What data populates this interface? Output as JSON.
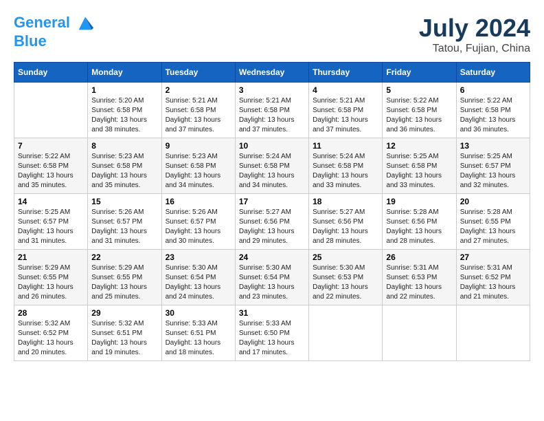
{
  "header": {
    "logo_line1": "General",
    "logo_line2": "Blue",
    "month_year": "July 2024",
    "location": "Tatou, Fujian, China"
  },
  "columns": [
    "Sunday",
    "Monday",
    "Tuesday",
    "Wednesday",
    "Thursday",
    "Friday",
    "Saturday"
  ],
  "weeks": [
    [
      {
        "day": "",
        "sunrise": "",
        "sunset": "",
        "daylight": ""
      },
      {
        "day": "1",
        "sunrise": "5:20 AM",
        "sunset": "6:58 PM",
        "daylight": "13 hours and 38 minutes."
      },
      {
        "day": "2",
        "sunrise": "5:21 AM",
        "sunset": "6:58 PM",
        "daylight": "13 hours and 37 minutes."
      },
      {
        "day": "3",
        "sunrise": "5:21 AM",
        "sunset": "6:58 PM",
        "daylight": "13 hours and 37 minutes."
      },
      {
        "day": "4",
        "sunrise": "5:21 AM",
        "sunset": "6:58 PM",
        "daylight": "13 hours and 37 minutes."
      },
      {
        "day": "5",
        "sunrise": "5:22 AM",
        "sunset": "6:58 PM",
        "daylight": "13 hours and 36 minutes."
      },
      {
        "day": "6",
        "sunrise": "5:22 AM",
        "sunset": "6:58 PM",
        "daylight": "13 hours and 36 minutes."
      }
    ],
    [
      {
        "day": "7",
        "sunrise": "5:22 AM",
        "sunset": "6:58 PM",
        "daylight": "13 hours and 35 minutes."
      },
      {
        "day": "8",
        "sunrise": "5:23 AM",
        "sunset": "6:58 PM",
        "daylight": "13 hours and 35 minutes."
      },
      {
        "day": "9",
        "sunrise": "5:23 AM",
        "sunset": "6:58 PM",
        "daylight": "13 hours and 34 minutes."
      },
      {
        "day": "10",
        "sunrise": "5:24 AM",
        "sunset": "6:58 PM",
        "daylight": "13 hours and 34 minutes."
      },
      {
        "day": "11",
        "sunrise": "5:24 AM",
        "sunset": "6:58 PM",
        "daylight": "13 hours and 33 minutes."
      },
      {
        "day": "12",
        "sunrise": "5:25 AM",
        "sunset": "6:58 PM",
        "daylight": "13 hours and 33 minutes."
      },
      {
        "day": "13",
        "sunrise": "5:25 AM",
        "sunset": "6:57 PM",
        "daylight": "13 hours and 32 minutes."
      }
    ],
    [
      {
        "day": "14",
        "sunrise": "5:25 AM",
        "sunset": "6:57 PM",
        "daylight": "13 hours and 31 minutes."
      },
      {
        "day": "15",
        "sunrise": "5:26 AM",
        "sunset": "6:57 PM",
        "daylight": "13 hours and 31 minutes."
      },
      {
        "day": "16",
        "sunrise": "5:26 AM",
        "sunset": "6:57 PM",
        "daylight": "13 hours and 30 minutes."
      },
      {
        "day": "17",
        "sunrise": "5:27 AM",
        "sunset": "6:56 PM",
        "daylight": "13 hours and 29 minutes."
      },
      {
        "day": "18",
        "sunrise": "5:27 AM",
        "sunset": "6:56 PM",
        "daylight": "13 hours and 28 minutes."
      },
      {
        "day": "19",
        "sunrise": "5:28 AM",
        "sunset": "6:56 PM",
        "daylight": "13 hours and 28 minutes."
      },
      {
        "day": "20",
        "sunrise": "5:28 AM",
        "sunset": "6:55 PM",
        "daylight": "13 hours and 27 minutes."
      }
    ],
    [
      {
        "day": "21",
        "sunrise": "5:29 AM",
        "sunset": "6:55 PM",
        "daylight": "13 hours and 26 minutes."
      },
      {
        "day": "22",
        "sunrise": "5:29 AM",
        "sunset": "6:55 PM",
        "daylight": "13 hours and 25 minutes."
      },
      {
        "day": "23",
        "sunrise": "5:30 AM",
        "sunset": "6:54 PM",
        "daylight": "13 hours and 24 minutes."
      },
      {
        "day": "24",
        "sunrise": "5:30 AM",
        "sunset": "6:54 PM",
        "daylight": "13 hours and 23 minutes."
      },
      {
        "day": "25",
        "sunrise": "5:30 AM",
        "sunset": "6:53 PM",
        "daylight": "13 hours and 22 minutes."
      },
      {
        "day": "26",
        "sunrise": "5:31 AM",
        "sunset": "6:53 PM",
        "daylight": "13 hours and 22 minutes."
      },
      {
        "day": "27",
        "sunrise": "5:31 AM",
        "sunset": "6:52 PM",
        "daylight": "13 hours and 21 minutes."
      }
    ],
    [
      {
        "day": "28",
        "sunrise": "5:32 AM",
        "sunset": "6:52 PM",
        "daylight": "13 hours and 20 minutes."
      },
      {
        "day": "29",
        "sunrise": "5:32 AM",
        "sunset": "6:51 PM",
        "daylight": "13 hours and 19 minutes."
      },
      {
        "day": "30",
        "sunrise": "5:33 AM",
        "sunset": "6:51 PM",
        "daylight": "13 hours and 18 minutes."
      },
      {
        "day": "31",
        "sunrise": "5:33 AM",
        "sunset": "6:50 PM",
        "daylight": "13 hours and 17 minutes."
      },
      {
        "day": "",
        "sunrise": "",
        "sunset": "",
        "daylight": ""
      },
      {
        "day": "",
        "sunrise": "",
        "sunset": "",
        "daylight": ""
      },
      {
        "day": "",
        "sunrise": "",
        "sunset": "",
        "daylight": ""
      }
    ]
  ],
  "labels": {
    "sunrise_prefix": "Sunrise: ",
    "sunset_prefix": "Sunset: ",
    "daylight_prefix": "Daylight: "
  }
}
